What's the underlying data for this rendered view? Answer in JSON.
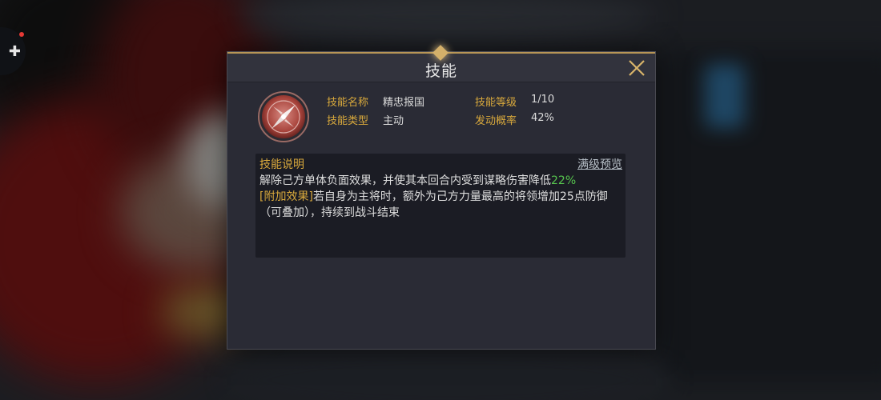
{
  "dialog": {
    "title": "技能",
    "close_icon": "close-icon"
  },
  "skill": {
    "icon": "skill-compass-icon",
    "name_label": "技能名称",
    "name_value": "精忠报国",
    "level_label": "技能等级",
    "level_value": "1/10",
    "type_label": "技能类型",
    "type_value": "主动",
    "rate_label": "发动概率",
    "rate_value": "42%"
  },
  "description": {
    "heading": "技能说明",
    "preview_link": "满级预览",
    "line1_text": "解除己方单体负面效果，并使其本回合内受到谋略伤害降低",
    "line1_value": "22%",
    "extra_tag": "[附加效果]",
    "extra_text": "若自身为主将时，额外为己方力量最高的将领增加25点防御（可叠加），持续到战斗结束"
  },
  "colors": {
    "label": "#d9a93c",
    "highlight": "#56c44e",
    "accent": "#b89656"
  }
}
